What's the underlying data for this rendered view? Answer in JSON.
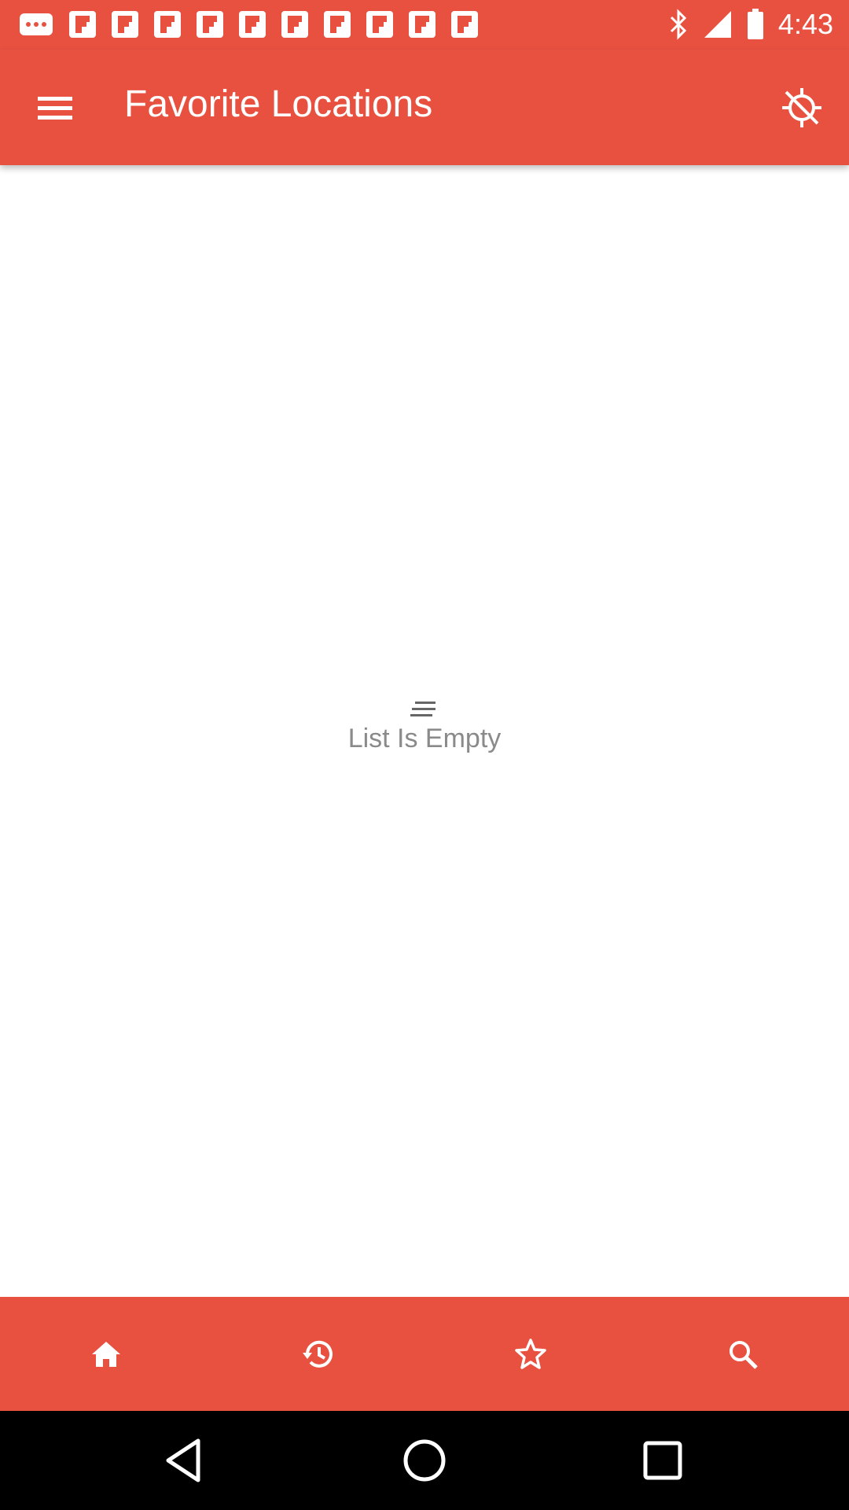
{
  "status_bar": {
    "time": "4:43",
    "icons": [
      "more-notifications-icon",
      "flipboard-icon",
      "flipboard-icon",
      "flipboard-icon",
      "flipboard-icon",
      "flipboard-icon",
      "flipboard-icon",
      "flipboard-icon",
      "flipboard-icon",
      "flipboard-icon",
      "flipboard-icon",
      "bluetooth-icon",
      "signal-icon",
      "battery-icon"
    ]
  },
  "app_bar": {
    "title": "Favorite Locations",
    "menu_icon": "hamburger-menu-icon",
    "action_icon": "gps-off-icon"
  },
  "empty_state": {
    "icon": "list-lines-icon",
    "text": "List Is Empty"
  },
  "bottom_nav": {
    "items": [
      {
        "icon": "home-icon"
      },
      {
        "icon": "history-icon"
      },
      {
        "icon": "star-icon"
      },
      {
        "icon": "search-icon"
      }
    ]
  },
  "system_nav": {
    "items": [
      "back-icon",
      "home-circle-icon",
      "recents-icon"
    ]
  },
  "colors": {
    "primary": "#e85140",
    "text_on_primary": "#ffffff",
    "empty_text": "#8a8a8a"
  }
}
